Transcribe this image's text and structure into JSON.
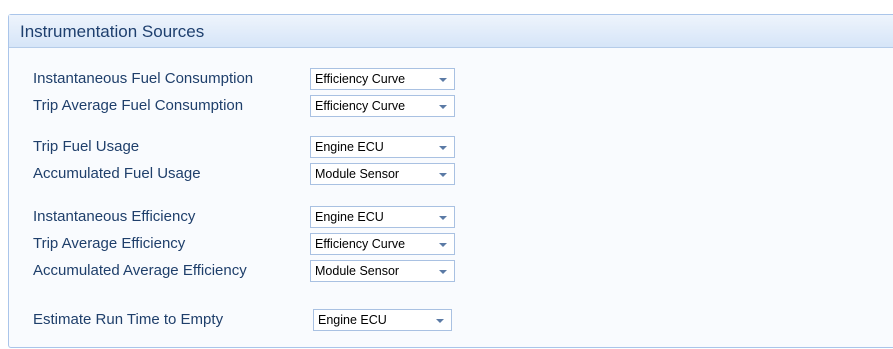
{
  "panel": {
    "title": "Instrumentation Sources"
  },
  "rows": [
    {
      "label": "Instantaneous Fuel Consumption",
      "value": "Efficiency Curve"
    },
    {
      "label": "Trip Average Fuel Consumption",
      "value": "Efficiency Curve"
    },
    {
      "label": "Trip Fuel Usage",
      "value": "Engine ECU"
    },
    {
      "label": "Accumulated Fuel Usage",
      "value": "Module Sensor"
    },
    {
      "label": "Instantaneous Efficiency",
      "value": "Engine ECU"
    },
    {
      "label": "Trip Average Efficiency",
      "value": "Efficiency Curve"
    },
    {
      "label": "Accumulated Average Efficiency",
      "value": "Module Sensor"
    },
    {
      "label": "Estimate Run Time to Empty",
      "value": "Engine ECU"
    }
  ],
  "colors": {
    "header_text": "#1e3f6e",
    "label_text": "#1f3f6b",
    "border": "#aac5ea"
  }
}
